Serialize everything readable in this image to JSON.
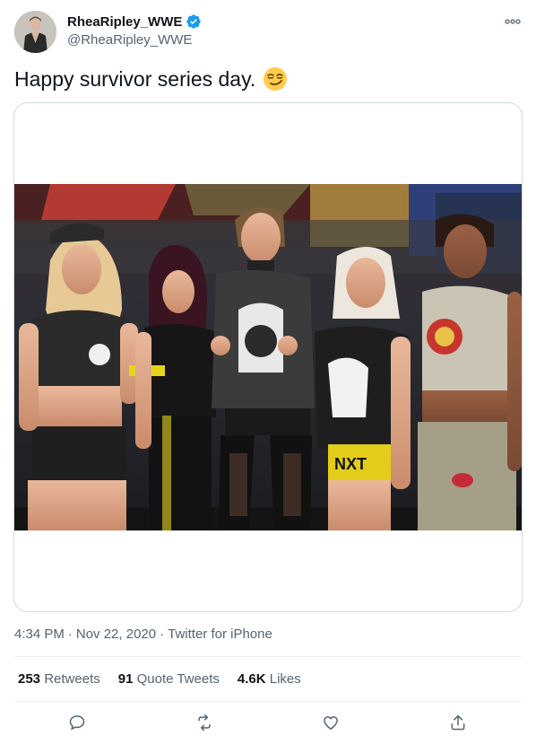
{
  "user": {
    "display_name": "RheaRipley_WWE",
    "handle": "@RheaRipley_WWE",
    "verified": true
  },
  "tweet": {
    "text": "Happy survivor series day.",
    "emoji": "smirking-face"
  },
  "meta": {
    "time": "4:34 PM",
    "sep1": "·",
    "date": "Nov 22, 2020",
    "sep2": "·",
    "source": "Twitter for iPhone"
  },
  "stats": {
    "retweets_count": "253",
    "retweets_label": "Retweets",
    "quotes_count": "91",
    "quotes_label": "Quote Tweets",
    "likes_count": "4.6K",
    "likes_label": "Likes"
  },
  "actions": [
    "reply",
    "retweet",
    "like",
    "share"
  ],
  "colors": {
    "verified": "#1d9bf0",
    "text": "#0f1419",
    "secondary": "#536471",
    "border": "#cfd9de"
  }
}
